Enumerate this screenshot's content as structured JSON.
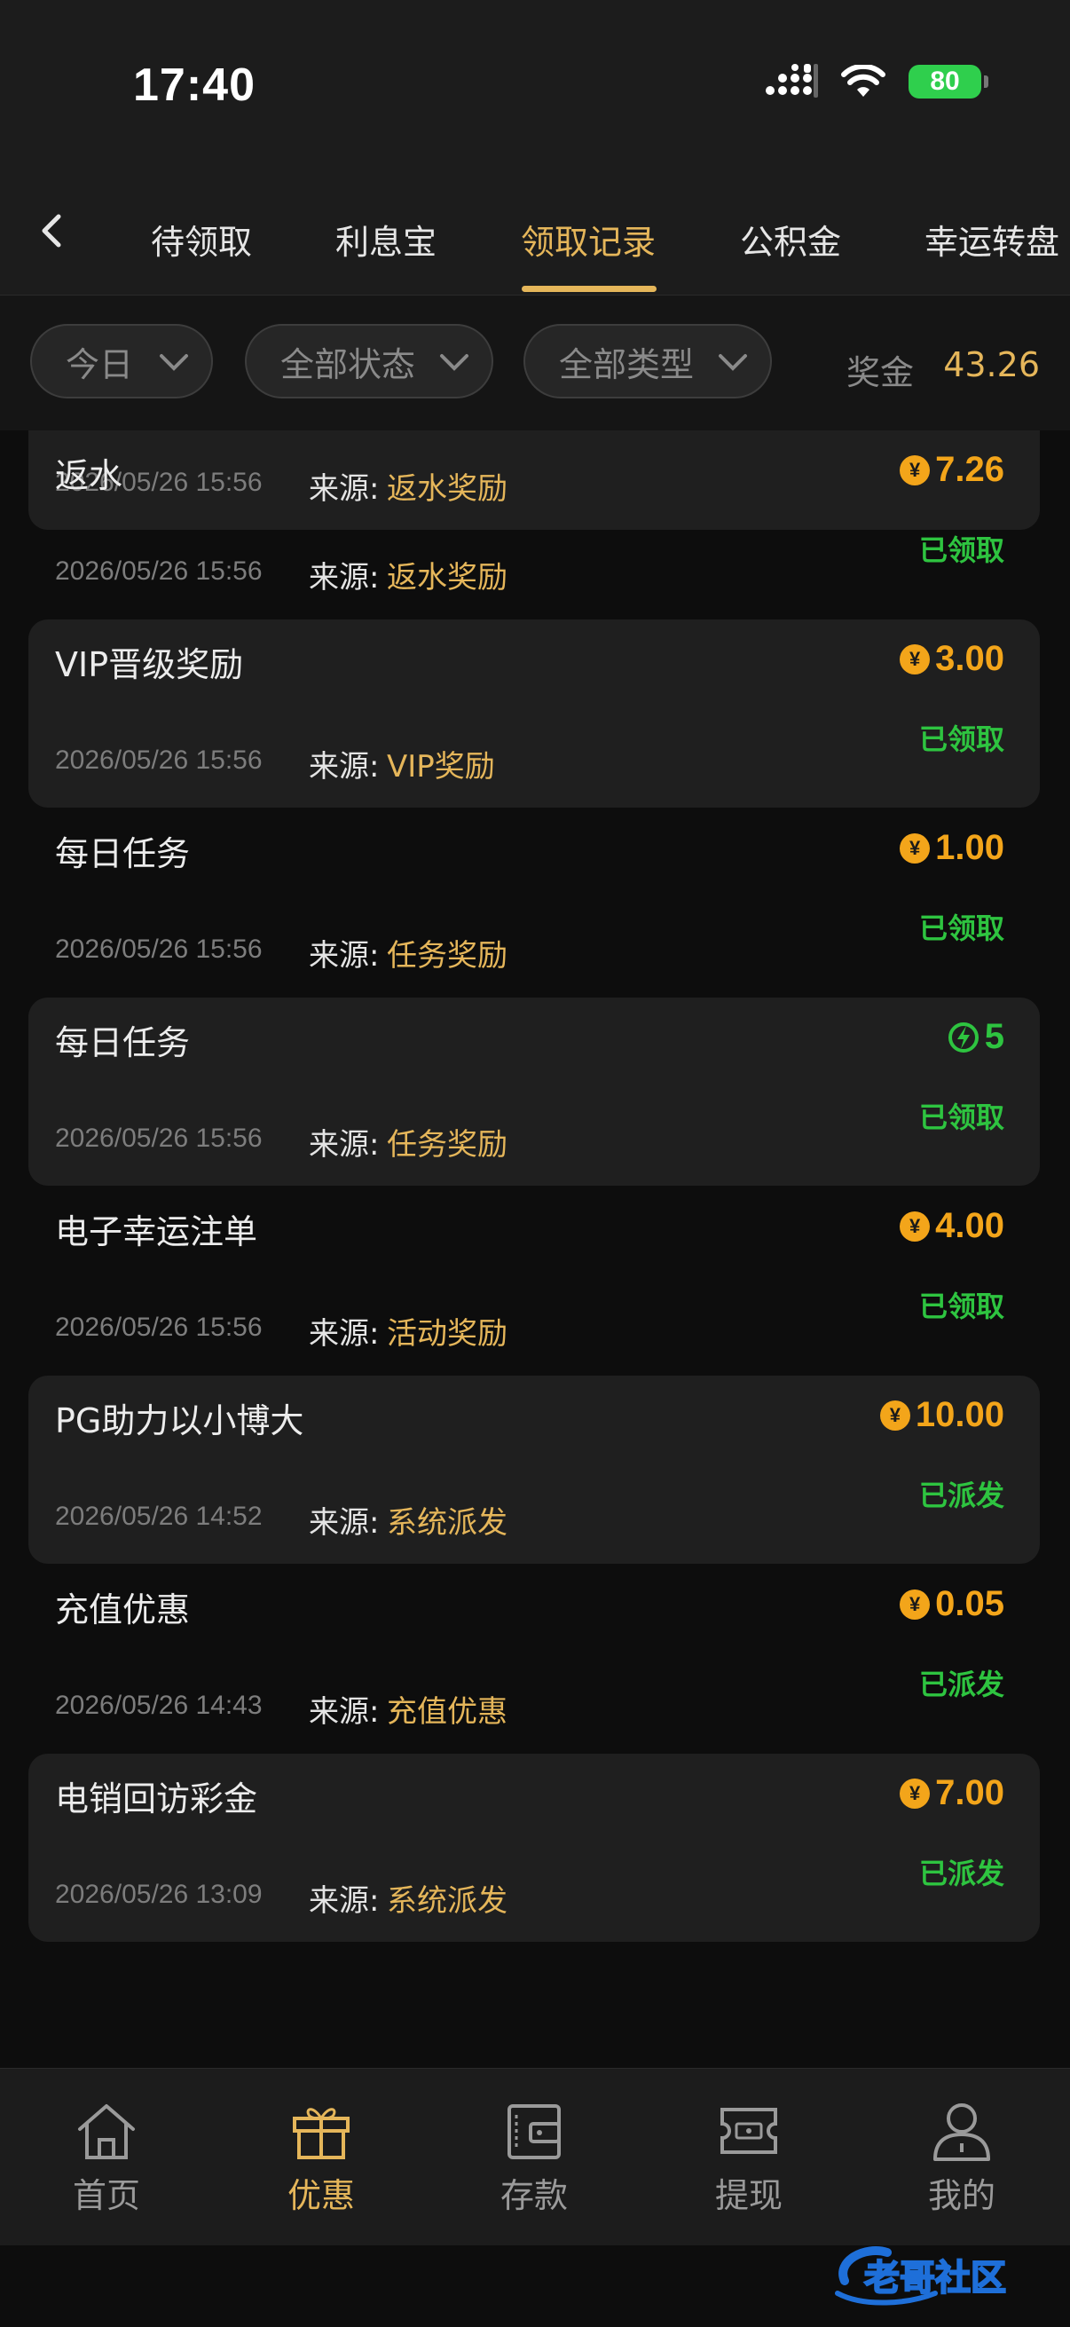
{
  "status_bar": {
    "time": "17:40",
    "battery": "80"
  },
  "tabs": [
    {
      "label": "待领取"
    },
    {
      "label": "利息宝"
    },
    {
      "label": "领取记录",
      "active": true
    },
    {
      "label": "公积金"
    },
    {
      "label": "幸运转盘"
    }
  ],
  "filters": {
    "date": "今日",
    "status": "全部状态",
    "type": "全部类型"
  },
  "bonus": {
    "label": "奖金",
    "value": "43.26"
  },
  "source_label": "来源:",
  "records": [
    {
      "title": "返水",
      "amount": "7.26",
      "currency": "coin",
      "status": "已领取",
      "date": "2026/05/26 15:56",
      "source": "返水奖励"
    },
    {
      "title": "VIP晋级奖励",
      "amount": "3.00",
      "currency": "coin",
      "status": "已领取",
      "date": "2026/05/26 15:56",
      "source": "VIP奖励"
    },
    {
      "title": "每日任务",
      "amount": "1.00",
      "currency": "coin",
      "status": "已领取",
      "date": "2026/05/26 15:56",
      "source": "任务奖励"
    },
    {
      "title": "每日任务",
      "amount": "5",
      "currency": "energy",
      "status": "已领取",
      "date": "2026/05/26 15:56",
      "source": "任务奖励"
    },
    {
      "title": "电子幸运注单",
      "amount": "4.00",
      "currency": "coin",
      "status": "已领取",
      "date": "2026/05/26 15:56",
      "source": "活动奖励"
    },
    {
      "title": "PG助力以小博大",
      "amount": "10.00",
      "currency": "coin",
      "status": "已派发",
      "date": "2026/05/26 14:52",
      "source": "系统派发"
    },
    {
      "title": "充值优惠",
      "amount": "0.05",
      "currency": "coin",
      "status": "已派发",
      "date": "2026/05/26 14:43",
      "source": "充值优惠"
    },
    {
      "title": "电销回访彩金",
      "amount": "7.00",
      "currency": "coin",
      "status": "已派发",
      "date": "2026/05/26 13:09",
      "source": "系统派发"
    }
  ],
  "partial_record": {
    "date": "2026/05/26 15:56",
    "source": "返水奖励"
  },
  "coin_symbol": "¥",
  "nav": [
    {
      "label": "首页",
      "icon": "home-icon"
    },
    {
      "label": "优惠",
      "icon": "gift-icon",
      "active": true
    },
    {
      "label": "存款",
      "icon": "wallet-icon"
    },
    {
      "label": "提现",
      "icon": "withdraw-icon"
    },
    {
      "label": "我的",
      "icon": "profile-icon"
    }
  ],
  "watermark": "老哥社区",
  "colors": {
    "accent": "#e5b65a",
    "coin": "#f3a51a",
    "success": "#2ec440",
    "background": "#0d0d0d"
  }
}
